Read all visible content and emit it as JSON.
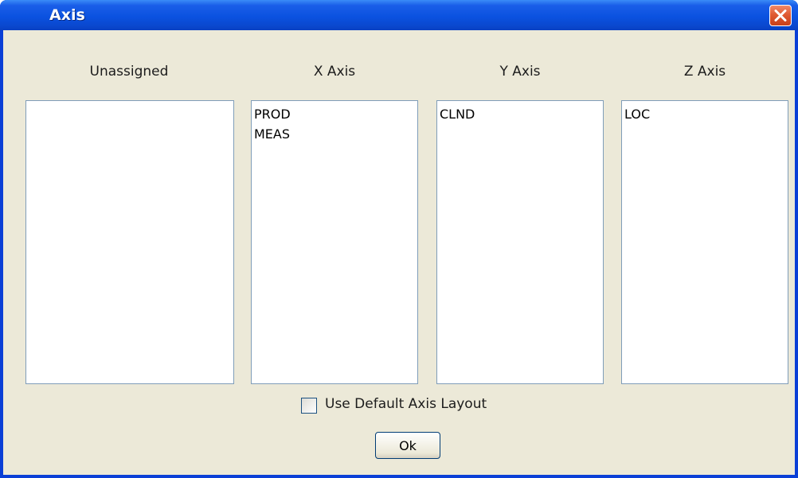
{
  "window": {
    "title": "Axis"
  },
  "columns": [
    {
      "label": "Unassigned",
      "items": []
    },
    {
      "label": "X Axis",
      "items": [
        "PROD",
        "MEAS"
      ]
    },
    {
      "label": "Y Axis",
      "items": [
        "CLND"
      ]
    },
    {
      "label": "Z Axis",
      "items": [
        "LOC"
      ]
    }
  ],
  "options": {
    "default_layout_label": "Use Default Axis Layout",
    "default_layout_checked": false
  },
  "buttons": {
    "ok_label": "Ok"
  },
  "icons": {
    "close": "close-icon"
  },
  "colors": {
    "titlebar": "#0b52e0",
    "close_button": "#e05a32",
    "dialog_bg": "#ece9d8",
    "list_border": "#7f9db9"
  }
}
